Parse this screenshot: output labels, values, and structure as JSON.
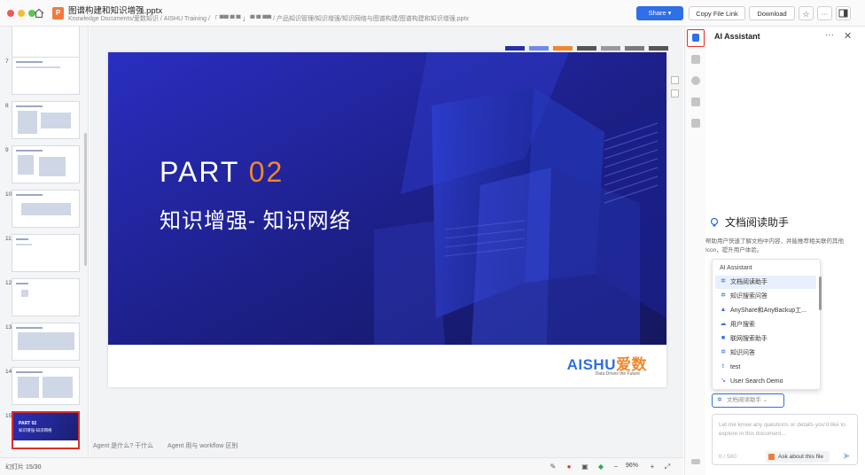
{
  "window": {
    "file_name": "图谱构建和知识增强.pptx",
    "file_icon_letter": "P",
    "file_path": "Knowledge Documents/爱数知识 / AISHU Training / 「 ▀▀ ▀ ▀ 」 ▀ ▀ ▀▀ / 产品知识管理/知识增强/知识网络与图谱构建/图谱构建和知识增强.pptx"
  },
  "toolbar": {
    "share_label": "Share ▾",
    "copy_link_label": "Copy File Link",
    "download_label": "Download",
    "star_icon": "star-icon",
    "more_label": "···"
  },
  "thumbnails": [
    {
      "num": "7"
    },
    {
      "num": "8"
    },
    {
      "num": "9"
    },
    {
      "num": "10"
    },
    {
      "num": "11"
    },
    {
      "num": "12"
    },
    {
      "num": "13"
    },
    {
      "num": "14"
    },
    {
      "num": "15",
      "active": true,
      "line1": "PART 02",
      "line2": "知识增强-知识网络"
    }
  ],
  "slide": {
    "part_label": "PART",
    "part_number": "02",
    "subtitle": "知识增强- 知识网络",
    "logo_a": "AISHU",
    "logo_b": "爱数",
    "logo_tag": "Data Drives the Future",
    "swatch_colors": [
      "#2630a8",
      "#6f8ae8",
      "#f2872a",
      "#555555",
      "#999999",
      "#7a7a7a",
      "#555555"
    ]
  },
  "notes": {
    "line1": "Agent 是什么? 干什么",
    "line2": "Agent 用与 workflow 区别"
  },
  "status": {
    "page_count": "幻灯片 15/30",
    "zoom": "96%",
    "zoom_minus": "−",
    "zoom_plus": "+"
  },
  "assistant": {
    "title": "AI Assistant",
    "more_label": "···",
    "close_label": "✕",
    "heading": "文档阅读助手",
    "description": "帮助用户快速了解文档中内容，并能推荐相关联的其他Icon，提升用户体验。",
    "dropdown_header": "AI Assistant",
    "items": [
      {
        "label": "文档阅读助手",
        "icon": "✲",
        "selected": true
      },
      {
        "label": "知识搜索问答",
        "icon": "✲"
      },
      {
        "label": "AnyShare和AnyBackup工...",
        "icon": "▲"
      },
      {
        "label": "用户搜索",
        "icon": "☁"
      },
      {
        "label": "联网搜索助手",
        "icon": "■"
      },
      {
        "label": "知识问答",
        "icon": "✲"
      },
      {
        "label": "test",
        "icon": "t"
      },
      {
        "label": "User Search Demo",
        "icon": "↘"
      }
    ],
    "selector_value": "文档阅读助手  ⌄",
    "input_placeholder": "Let me know any questions or details you'd like to explore in this document...",
    "char_count": "0 / 500",
    "ask_label": "Ask about this file",
    "send_icon": "➤"
  }
}
